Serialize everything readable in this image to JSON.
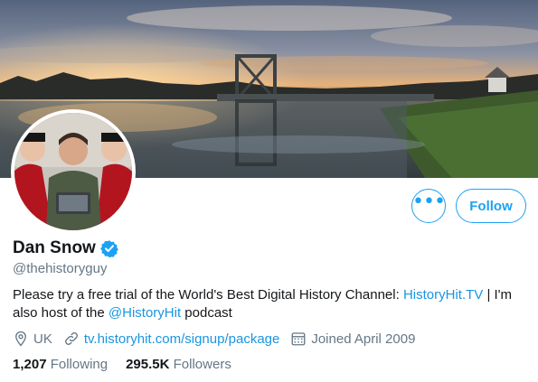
{
  "profile": {
    "display_name": "Dan Snow",
    "handle": "@thehistoryguy",
    "verified": true
  },
  "actions": {
    "more_label": "•••",
    "follow_label": "Follow"
  },
  "bio": {
    "text_before": "Please try a free trial of the World's Best Digital History Channel: ",
    "link1": "HistoryHit.TV",
    "text_middle": " | I'm also host of the ",
    "link2": "@HistoryHit",
    "text_after": " podcast"
  },
  "meta": {
    "location": "UK",
    "website": "tv.historyhit.com/signup/package",
    "joined": "Joined April 2009",
    "icons": [
      "location-pin-icon",
      "link-icon",
      "calendar-icon"
    ]
  },
  "stats": {
    "following_count": "1,207",
    "following_label": "Following",
    "followers_count": "295.5K",
    "followers_label": "Followers"
  },
  "colors": {
    "accent": "#1da1f2",
    "link": "#1b95e0",
    "secondary_text": "#657786",
    "primary_text": "#14171a"
  }
}
